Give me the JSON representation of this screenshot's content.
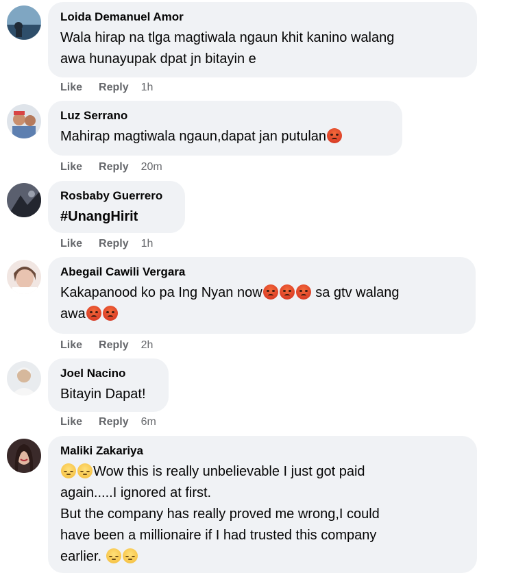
{
  "comments": [
    {
      "author": "Loida Demanuel Amor",
      "text": "Wala hirap na tlga magtiwala ngaun khit kanino walang\nawa hunayupak dpat jn bitayin e",
      "like": "Like",
      "reply": "Reply",
      "time": "1h"
    },
    {
      "author": "Luz Serrano",
      "text": "Mahirap magtiwala ngaun,dapat jan putulan",
      "like": "Like",
      "reply": "Reply",
      "time": "20m"
    },
    {
      "author": "Rosbaby Guerrero",
      "text": "#UnangHirit",
      "like": "Like",
      "reply": "Reply",
      "time": "1h"
    },
    {
      "author": "Abegail Cawili Vergara",
      "text_part1": "Kakapanood ko pa Ing Nyan now",
      "text_part2": " sa gtv walang",
      "text_part3": "awa",
      "like": "Like",
      "reply": "Reply",
      "time": "2h"
    },
    {
      "author": "Joel Nacino",
      "text": "Bitayin Dapat!",
      "like": "Like",
      "reply": "Reply",
      "time": "6m"
    },
    {
      "author": "Maliki Zakariya",
      "text_part1": "Wow this is really unbelievable I just got paid",
      "text_part2": "again.....I ignored at first.\nBut the company has really proved me wrong,I could\nhave been a millionaire if I had trusted this company\nearlier. "
    }
  ],
  "icons": {
    "angry": "angry-face-emoji",
    "relieved": "relieved-face-emoji"
  }
}
